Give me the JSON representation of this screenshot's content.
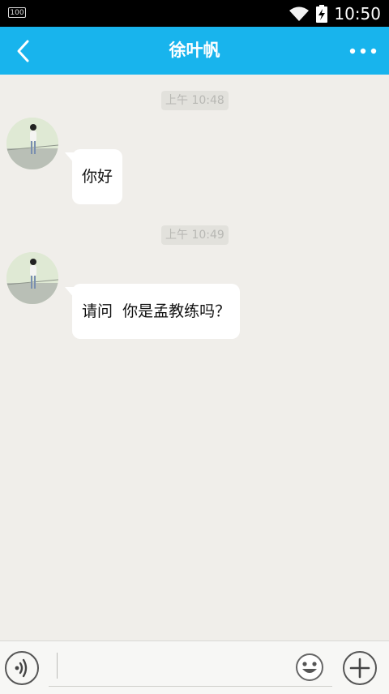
{
  "status_bar": {
    "battery_text": "100",
    "time": "10:50",
    "icons": [
      "wifi-icon",
      "battery-charging-icon"
    ]
  },
  "header": {
    "title": "徐叶帆",
    "back_icon": "chevron-left-icon",
    "more_icon": "more-dots-icon",
    "background": "#18b4ed"
  },
  "messages": [
    {
      "timestamp": "上午 10:48",
      "text": "你好"
    },
    {
      "timestamp": "上午 10:49",
      "text": "请问  你是孟教练吗？"
    }
  ],
  "input_bar": {
    "voice_icon": "voice-icon",
    "emoji_icon": "emoji-icon",
    "plus_icon": "plus-icon",
    "value": "",
    "placeholder": ""
  }
}
